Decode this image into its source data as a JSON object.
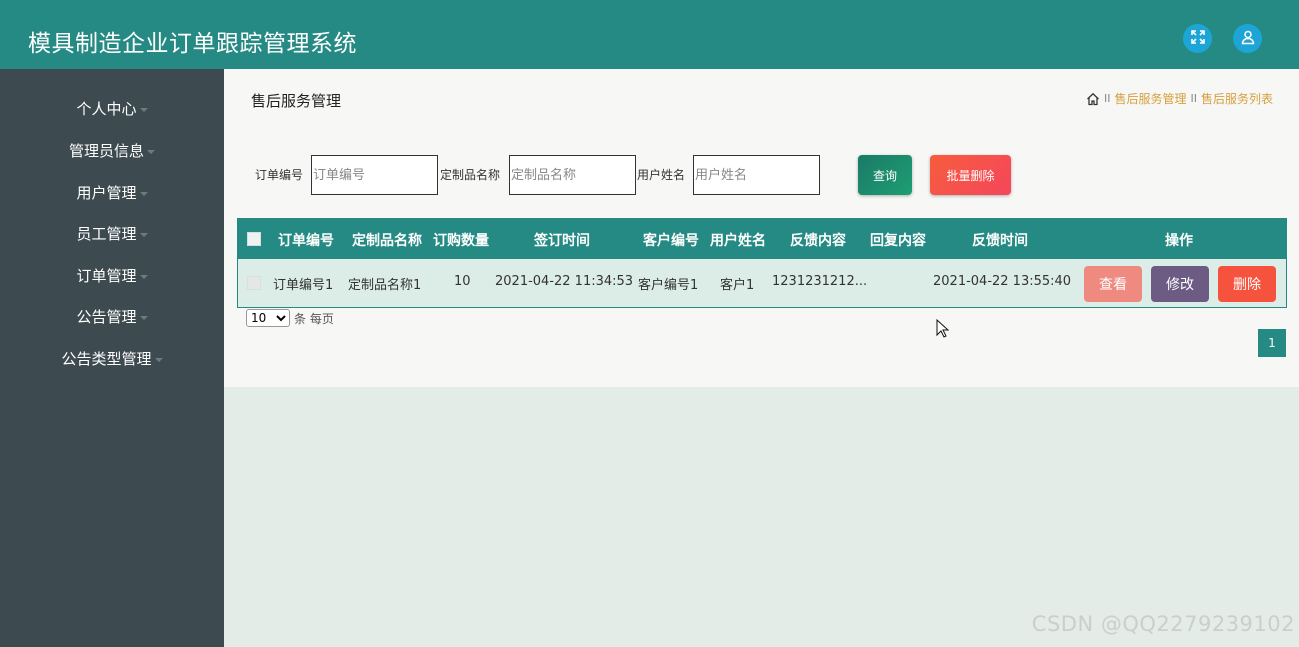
{
  "app": {
    "title": "模具制造企业订单跟踪管理系统"
  },
  "header": {
    "fullscreen_icon": "fullscreen-icon",
    "user_icon": "user-icon"
  },
  "sidebar": {
    "items": [
      {
        "label": "个人中心"
      },
      {
        "label": "管理员信息"
      },
      {
        "label": "用户管理"
      },
      {
        "label": "员工管理"
      },
      {
        "label": "订单管理"
      },
      {
        "label": "公告管理"
      },
      {
        "label": "公告类型管理"
      }
    ]
  },
  "page": {
    "title": "售后服务管理",
    "breadcrumb": {
      "sep": "II",
      "items": [
        "售后服务管理",
        "售后服务列表"
      ]
    }
  },
  "filters": {
    "order_no": {
      "label": "订单编号",
      "placeholder": "订单编号"
    },
    "product_name": {
      "label": "定制品名称",
      "placeholder": "定制品名称"
    },
    "user_name": {
      "label": "用户姓名",
      "placeholder": "用户姓名"
    },
    "query_label": "查询",
    "batch_delete_label": "批量删除"
  },
  "table": {
    "headers": [
      "订单编号",
      "定制品名称",
      "订购数量",
      "签订时间",
      "客户编号",
      "用户姓名",
      "反馈内容",
      "回复内容",
      "反馈时间",
      "操作"
    ],
    "rows": [
      {
        "order_no": "订单编号1",
        "product_name": "定制品名称1",
        "quantity": "10",
        "sign_time": "2021-04-22 11:34:53",
        "customer_no": "客户编号1",
        "user_name": "客户1",
        "feedback": "1231231212...",
        "reply": "",
        "feedback_time": "2021-04-22 13:55:40",
        "actions": {
          "view": "查看",
          "edit": "修改",
          "delete": "删除"
        }
      }
    ]
  },
  "pagination": {
    "page_size": "10",
    "page_size_options": [
      "10"
    ],
    "per_page_label": "条 每页",
    "current_page": "1"
  },
  "watermark": "CSDN @QQ2279239102",
  "colors": {
    "header": "#248a83",
    "sidebar": "#3d4a4f",
    "accent": "#248a83",
    "danger": "#f6533f",
    "breadcrumb": "#d59f3d"
  }
}
